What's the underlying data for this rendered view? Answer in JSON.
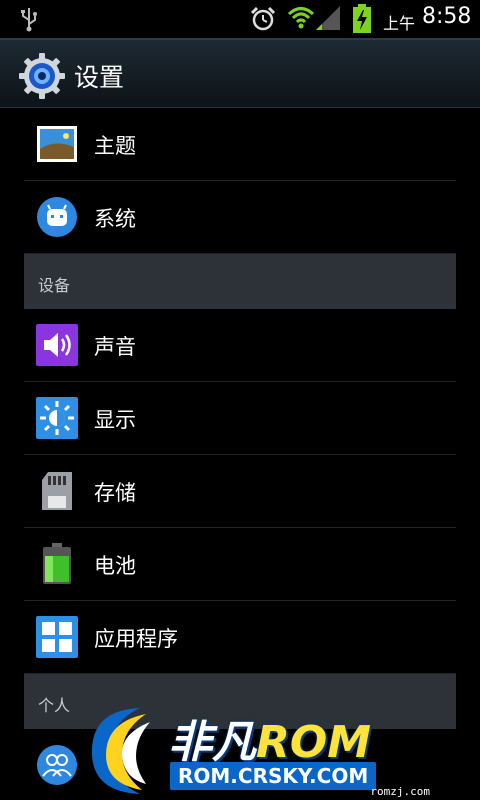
{
  "status_bar": {
    "ampm": "上午",
    "time": "8:58"
  },
  "action_bar": {
    "title": "设置"
  },
  "list": {
    "items": [
      {
        "label": "主题"
      },
      {
        "label": "系统"
      }
    ],
    "section_device": "设备",
    "device_items": [
      {
        "label": "声音"
      },
      {
        "label": "显示"
      },
      {
        "label": "存储"
      },
      {
        "label": "电池"
      },
      {
        "label": "应用程序"
      }
    ],
    "section_personal": "个人"
  },
  "watermark": {
    "main_cn": "非凡",
    "main_en": "ROM",
    "sub": "ROM.CRSKY.COM",
    "site": "romzj.com"
  }
}
